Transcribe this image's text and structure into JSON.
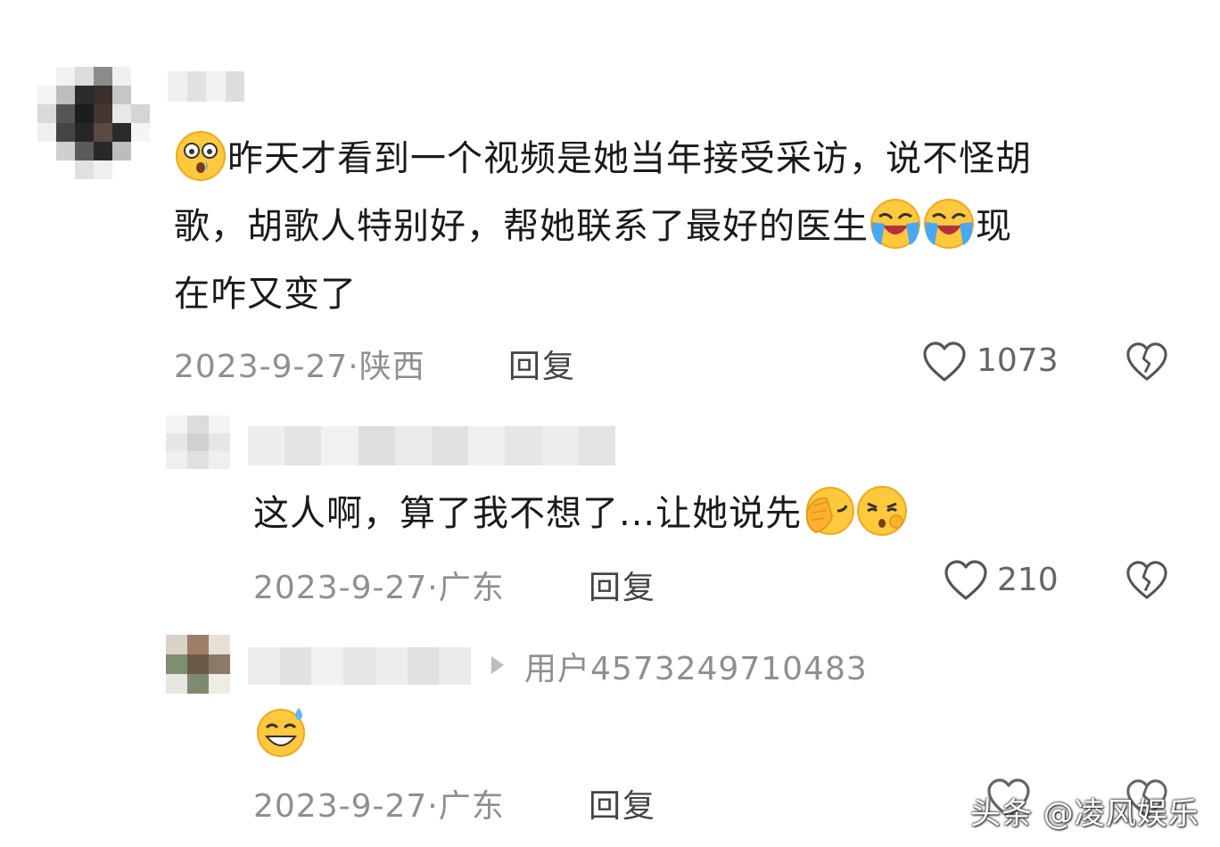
{
  "comments": [
    {
      "text_before": "昨天才看到一个视频是她当年接受采访，说不怪胡",
      "text_line2": "歌，胡歌人特别好，帮她联系了最好的医生",
      "text_after_emoji": "现",
      "text_line3": "在咋又变了",
      "date": "2023-9-27·",
      "location": "陕西",
      "reply_label": "回复",
      "likes": "1073",
      "emojis": [
        "astonished-emoji",
        "loudly-crying-emoji",
        "loudly-crying-emoji"
      ]
    },
    {
      "text": "这人啊，算了我不想了...让她说先",
      "date": "2023-9-27·",
      "location": "广东",
      "reply_label": "回复",
      "likes": "210",
      "emojis": [
        "facepalm-emoji",
        "pouting-emoji"
      ]
    },
    {
      "reply_to": "用户4573249710483",
      "date": "2023-9-27·",
      "location": "广东",
      "reply_label": "回复",
      "emojis": [
        "grinning-sweat-emoji"
      ]
    }
  ],
  "watermark": "头条 @凌风娱乐",
  "icons": {
    "like": "heart-outline-icon",
    "dislike": "broken-heart-icon",
    "reply_arrow": "triangle-right-icon"
  }
}
